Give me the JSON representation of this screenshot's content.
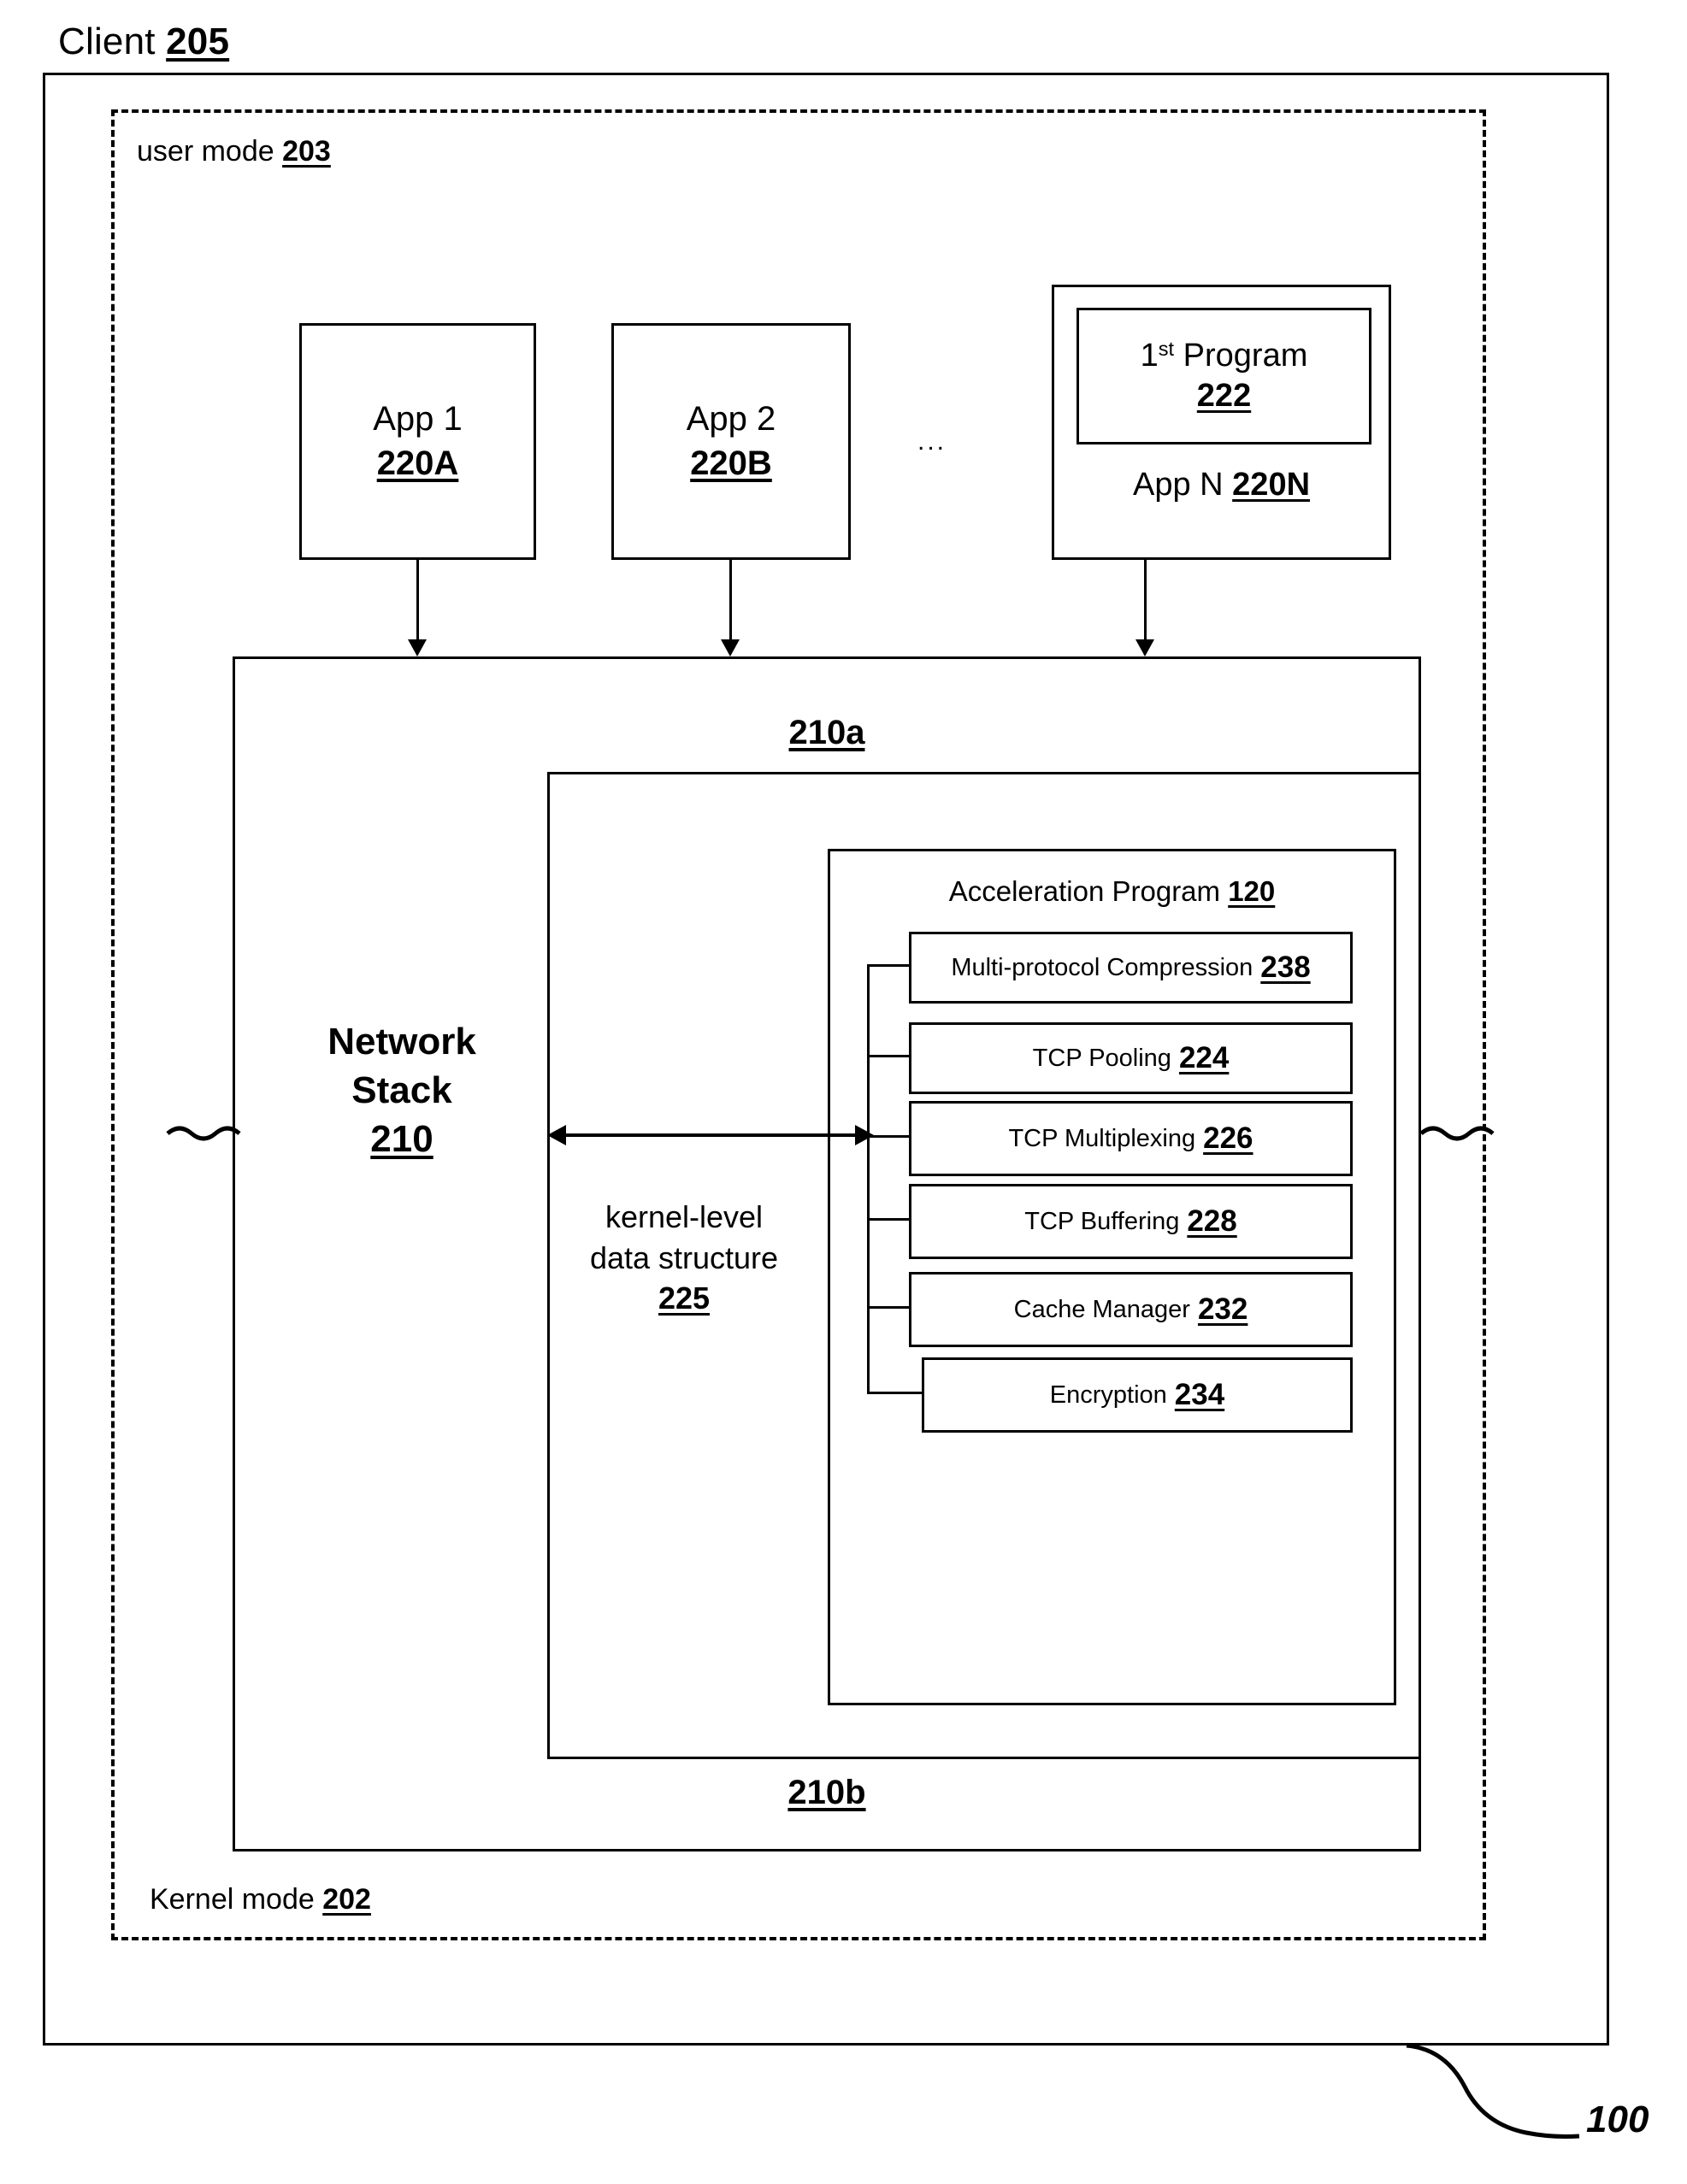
{
  "figure": {
    "title_text": "Client",
    "title_num": "205",
    "ref_label": "100"
  },
  "modes": {
    "user": {
      "label": "user  mode",
      "num": "203"
    },
    "kernel": {
      "label": "Kernel mode",
      "num": "202"
    }
  },
  "apps": {
    "ellipsis": "...",
    "items": [
      {
        "name": "App 1",
        "num": "220A"
      },
      {
        "name": "App 2",
        "num": "220B"
      }
    ],
    "app_n": {
      "program_prefix": "1",
      "program_sup": "st",
      "program_name": "Program",
      "program_num": "222",
      "label": "App N",
      "num": "220N"
    }
  },
  "network_stack": {
    "label_line1": "Network",
    "label_line2": "Stack",
    "num": "210",
    "upper_layer": "210a",
    "lower_layer": "210b",
    "kernel_data_structure": {
      "line1": "kernel-level",
      "line2": "data structure",
      "num": "225"
    }
  },
  "acceleration_program": {
    "title": "Acceleration Program",
    "num": "120",
    "features": [
      {
        "label": "Multi-protocol Compression",
        "num": "238"
      },
      {
        "label": "TCP Pooling",
        "num": "224"
      },
      {
        "label": "TCP Multiplexing",
        "num": "226"
      },
      {
        "label": "TCP Buffering",
        "num": "228"
      },
      {
        "label": "Cache Manager",
        "num": "232"
      },
      {
        "label": "Encryption",
        "num": "234"
      }
    ]
  },
  "colors": {
    "line": "#000000",
    "background": "#ffffff"
  }
}
